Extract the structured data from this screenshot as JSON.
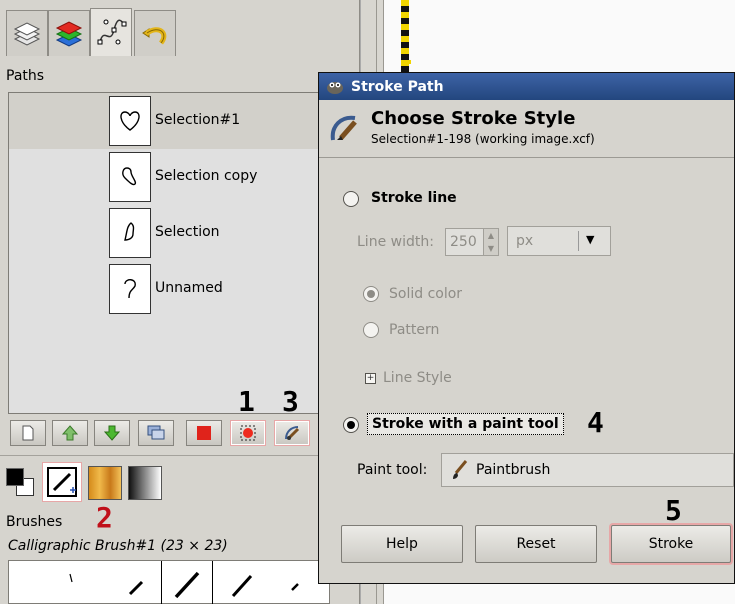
{
  "dock": {
    "tabs": [
      {
        "name": "layers-tab-icon"
      },
      {
        "name": "channels-tab-icon"
      },
      {
        "name": "paths-tab-icon"
      },
      {
        "name": "undo-history-tab-icon"
      }
    ],
    "paths_title": "Paths",
    "paths": [
      {
        "label": "Selection#1",
        "selected": true
      },
      {
        "label": "Selection copy",
        "selected": false
      },
      {
        "label": "Selection",
        "selected": false
      },
      {
        "label": "Unnamed",
        "selected": false
      }
    ],
    "toolbar_buttons": [
      "new-path-icon",
      "raise-path-icon",
      "lower-path-icon",
      "duplicate-path-icon",
      "delete-path-icon",
      "path-to-selection-icon",
      "stroke-path-icon"
    ],
    "annotations": {
      "one": "1",
      "two": "2",
      "three": "3",
      "four": "4",
      "five": "5"
    },
    "brushes_title": "Brushes",
    "brush_name": "Calligraphic Brush#1 (23 × 23)"
  },
  "dialog": {
    "title": "Stroke Path",
    "header_title": "Choose Stroke Style",
    "header_subtitle": "Selection#1-198 (working image.xcf)",
    "stroke_line_label": "Stroke line",
    "line_width_label": "Line width:",
    "line_width_value": "250",
    "unit_value": "px",
    "solid_color_label": "Solid color",
    "pattern_label": "Pattern",
    "line_style_label": "Line Style",
    "stroke_paint_tool_label": "Stroke with a paint tool",
    "paint_tool_label": "Paint tool:",
    "paint_tool_value": "Paintbrush",
    "buttons": {
      "help": "Help",
      "reset": "Reset",
      "stroke": "Stroke"
    }
  },
  "colors": {
    "annotation_red": "#c0101a",
    "title_bar": "#2f5597",
    "highlight_border": "#e7a7a7"
  }
}
